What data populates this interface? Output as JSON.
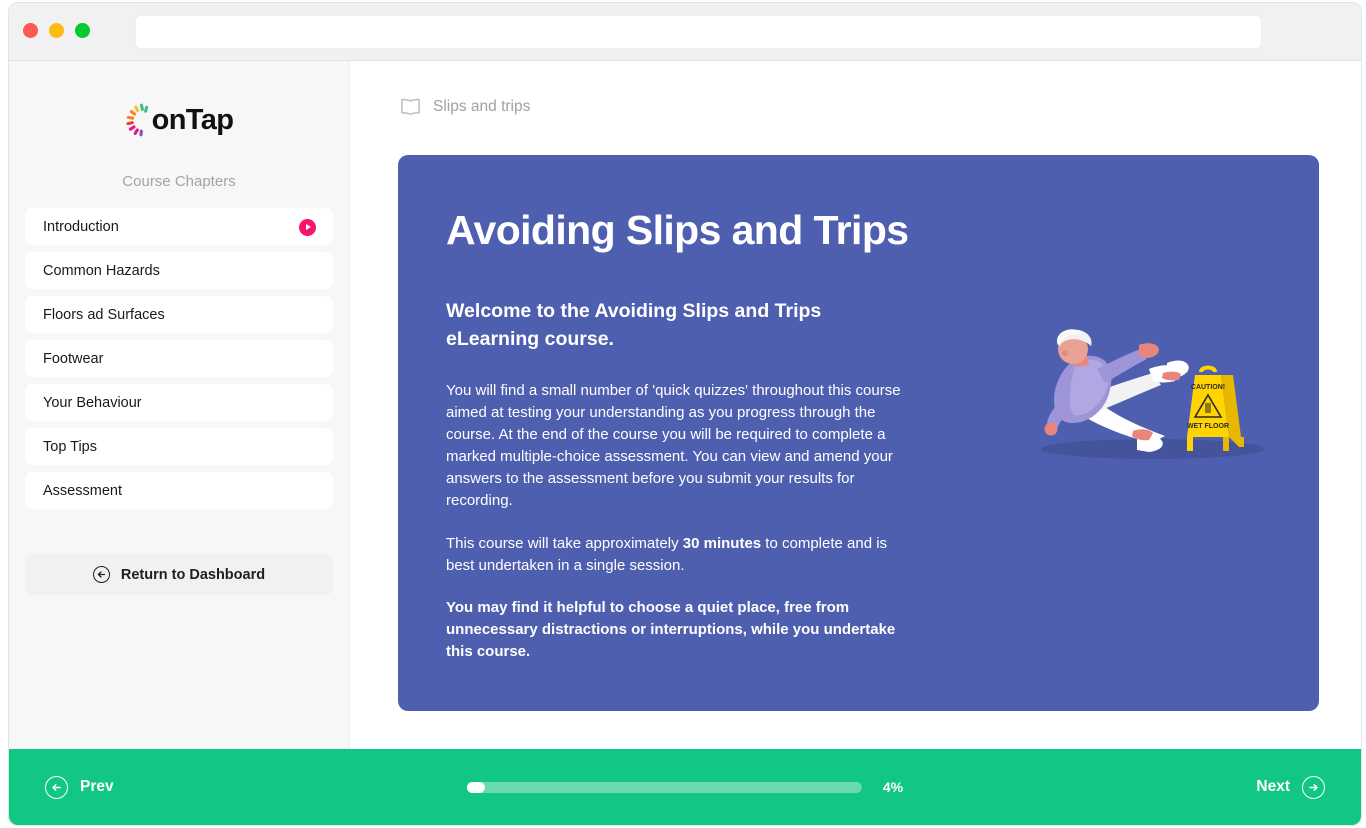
{
  "browser": {
    "traffic_lights": [
      "close",
      "minimize",
      "maximize"
    ],
    "address_value": "",
    "address_placeholder": ""
  },
  "sidebar": {
    "logo_text": "onTap",
    "logo_mark_colors": [
      "#3ac47d",
      "#f7c325",
      "#f58220",
      "#ef3b42",
      "#e5197f",
      "#8a4fbe"
    ],
    "chapters_heading": "Course Chapters",
    "items": [
      {
        "label": "Introduction",
        "status": "playing"
      },
      {
        "label": "Common Hazards",
        "status": "locked"
      },
      {
        "label": "Floors ad Surfaces",
        "status": "locked"
      },
      {
        "label": "Footwear",
        "status": "locked"
      },
      {
        "label": "Your Behaviour",
        "status": "locked"
      },
      {
        "label": "Top Tips",
        "status": "locked"
      },
      {
        "label": "Assessment",
        "status": "locked"
      }
    ],
    "return_label": "Return to Dashboard"
  },
  "breadcrumb": {
    "icon": "book-icon",
    "label": "Slips and trips"
  },
  "hero": {
    "title": "Avoiding Slips and Trips",
    "subtitle": "Welcome to the Avoiding Slips and Trips eLearning course.",
    "paragraph1": "You will find a small number of 'quick quizzes' throughout this course aimed at testing your understanding as you progress through the course.  At the end of the course you will be required to complete a marked multiple-choice assessment. You can view and amend your answers to the assessment before you submit your results for recording.",
    "paragraph2_before": "This course will take approximately ",
    "paragraph2_bold": "30 minutes",
    "paragraph2_after": " to complete and is best undertaken in a single session.",
    "paragraph3": "You may find it helpful to choose a quiet place, free from unnecessary distractions or interruptions, while you undertake this course.",
    "background_color": "#4f5fb0",
    "illustration": {
      "name": "person-slipping-wet-floor-illustration",
      "sign_line1": "CAUTION!",
      "sign_line2": "WET FLOOR"
    }
  },
  "footer": {
    "prev_label": "Prev",
    "next_label": "Next",
    "progress_percent": 4,
    "progress_label": "4%",
    "background_color": "#12c684"
  }
}
